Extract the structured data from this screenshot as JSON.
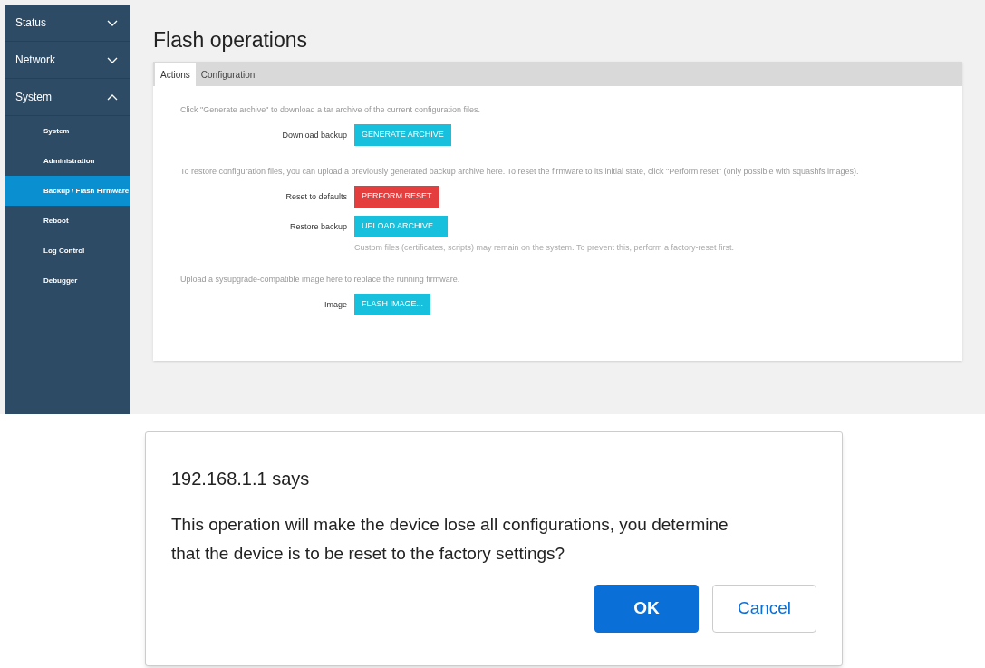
{
  "sidebar": {
    "items": [
      {
        "label": "Status",
        "expanded": false
      },
      {
        "label": "Network",
        "expanded": false
      },
      {
        "label": "System",
        "expanded": true,
        "children": [
          {
            "label": "System",
            "selected": false
          },
          {
            "label": "Administration",
            "selected": false
          },
          {
            "label": "Backup / Flash Firmware",
            "selected": true
          },
          {
            "label": "Reboot",
            "selected": false
          },
          {
            "label": "Log Control",
            "selected": false
          },
          {
            "label": "Debugger",
            "selected": false
          }
        ]
      }
    ]
  },
  "page": {
    "title": "Flash operations",
    "tabs": [
      {
        "label": "Actions",
        "selected": true
      },
      {
        "label": "Configuration",
        "selected": false
      }
    ],
    "sections": [
      {
        "description": "Click \"Generate archive\" to download a tar archive of the current configuration files.",
        "rows": [
          {
            "label": "Download backup",
            "button": "GENERATE ARCHIVE",
            "kind": "primary"
          }
        ]
      },
      {
        "description": "To restore configuration files, you can upload a previously generated backup archive here. To reset the firmware to its initial state, click \"Perform reset\" (only possible with squashfs images).",
        "rows": [
          {
            "label": "Reset to defaults",
            "button": "PERFORM RESET",
            "kind": "danger"
          },
          {
            "label": "Restore backup",
            "button": "UPLOAD ARCHIVE...",
            "kind": "primary",
            "note": "Custom files (certificates, scripts) may remain on the system. To prevent this, perform a factory-reset first."
          }
        ]
      },
      {
        "description": "Upload a sysupgrade-compatible image here to replace the running firmware.",
        "rows": [
          {
            "label": "Image",
            "button": "FLASH IMAGE...",
            "kind": "primary"
          }
        ]
      }
    ]
  },
  "dialog": {
    "title": "192.168.1.1 says",
    "message": "This operation will make the device lose all configurations, you determine that the device is to be reset to the factory settings?",
    "buttons": [
      {
        "label": "OK",
        "kind": "primary"
      },
      {
        "label": "Cancel",
        "kind": "secondary"
      }
    ]
  }
}
